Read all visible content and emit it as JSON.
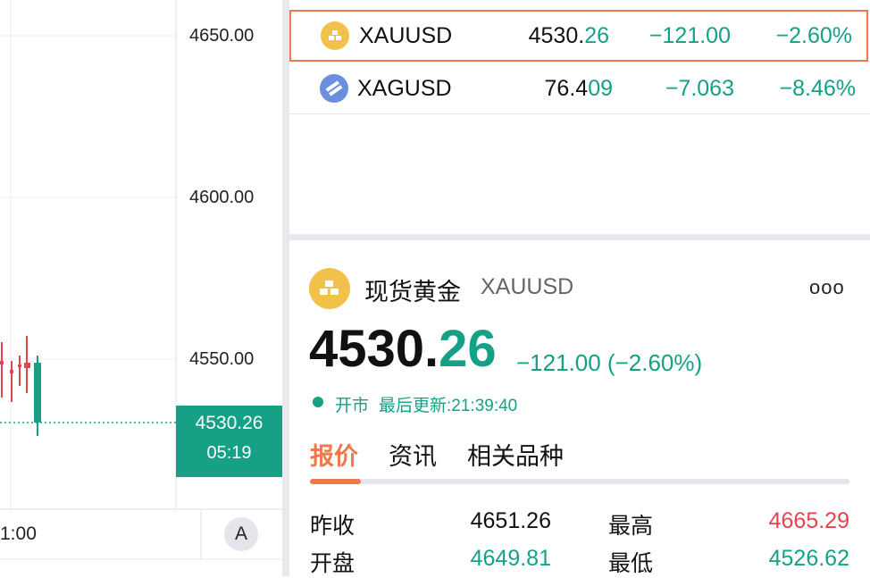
{
  "chart": {
    "price_levels": [
      "4650.00",
      "4600.00",
      "4550.00"
    ],
    "current_price_tag": "4530.26",
    "countdown": "05:19",
    "time_axis_label": "1:00",
    "auto_scale_button": "A",
    "colors": {
      "down": "#16a085",
      "up": "#e4434f"
    }
  },
  "watchlist": {
    "rows": [
      {
        "symbol": "XAUUSD",
        "icon": "gold-bars-icon",
        "last_main": "4530.",
        "last_hi": "26",
        "change": "−121.00",
        "percent": "−2.60%",
        "selected": true
      },
      {
        "symbol": "XAGUSD",
        "icon": "silver-bars-icon",
        "last_main": "76.4",
        "last_hi": "09",
        "change": "−7.063",
        "percent": "−8.46%",
        "selected": false
      }
    ]
  },
  "detail": {
    "name": "现货黄金",
    "symbol": "XAUUSD",
    "more_label": "ooo",
    "price_main": "4530.",
    "price_hi": "26",
    "change_text": "−121.00 (−2.60%)",
    "status": "开市",
    "last_update": "最后更新:21:39:40",
    "tabs": [
      "报价",
      "资讯",
      "相关品种"
    ],
    "active_tab": 0,
    "quotes": [
      {
        "label": "昨收",
        "value": "4651.26",
        "tone": "neutral"
      },
      {
        "label": "最高",
        "value": "4665.29",
        "tone": "up"
      },
      {
        "label": "开盘",
        "value": "4649.81",
        "tone": "down"
      },
      {
        "label": "最低",
        "value": "4526.62",
        "tone": "down"
      }
    ]
  },
  "accent_color": "#f0784d",
  "down_color": "#16a085",
  "up_color": "#e4434f"
}
